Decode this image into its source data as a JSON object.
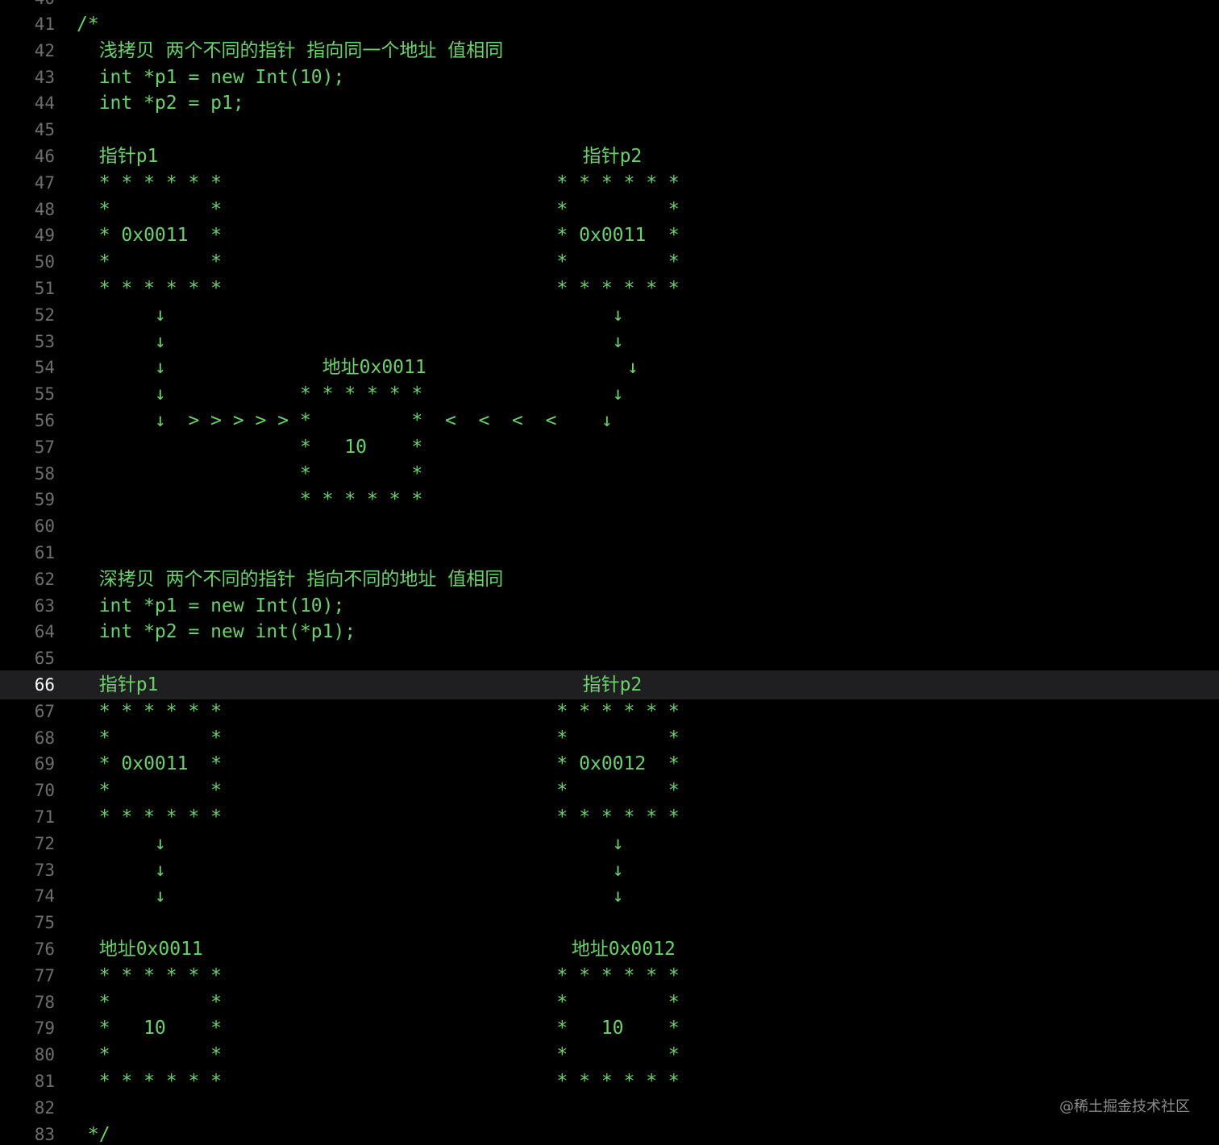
{
  "editor": {
    "top_partial_line": "40",
    "current_line": "66",
    "lines": [
      {
        "num": "41",
        "text": "/*"
      },
      {
        "num": "42",
        "text": "  浅拷贝 两个不同的指针 指向同一个地址 值相同"
      },
      {
        "num": "43",
        "text": "  int *p1 = new Int(10);"
      },
      {
        "num": "44",
        "text": "  int *p2 = p1;"
      },
      {
        "num": "45",
        "text": ""
      },
      {
        "num": "46",
        "text": "  指针p1                                      指针p2"
      },
      {
        "num": "47",
        "text": "  * * * * * *                              * * * * * *"
      },
      {
        "num": "48",
        "text": "  *         *                              *         *"
      },
      {
        "num": "49",
        "text": "  * 0x0011  *                              * 0x0011  *"
      },
      {
        "num": "50",
        "text": "  *         *                              *         *"
      },
      {
        "num": "51",
        "text": "  * * * * * *                              * * * * * *"
      },
      {
        "num": "52",
        "text": "       ↓                                        ↓"
      },
      {
        "num": "53",
        "text": "       ↓                                        ↓"
      },
      {
        "num": "54",
        "text": "       ↓              地址0x0011                  ↓"
      },
      {
        "num": "55",
        "text": "       ↓            * * * * * *                 ↓"
      },
      {
        "num": "56",
        "text": "       ↓  > > > > > *         *  <  <  <  <    ↓"
      },
      {
        "num": "57",
        "text": "                    *   10    *"
      },
      {
        "num": "58",
        "text": "                    *         *"
      },
      {
        "num": "59",
        "text": "                    * * * * * *"
      },
      {
        "num": "60",
        "text": ""
      },
      {
        "num": "61",
        "text": ""
      },
      {
        "num": "62",
        "text": "  深拷贝 两个不同的指针 指向不同的地址 值相同"
      },
      {
        "num": "63",
        "text": "  int *p1 = new Int(10);"
      },
      {
        "num": "64",
        "text": "  int *p2 = new int(*p1);"
      },
      {
        "num": "65",
        "text": ""
      },
      {
        "num": "66",
        "text": "  指针p1                                      指针p2"
      },
      {
        "num": "67",
        "text": "  * * * * * *                              * * * * * *"
      },
      {
        "num": "68",
        "text": "  *         *                              *         *"
      },
      {
        "num": "69",
        "text": "  * 0x0011  *                              * 0x0012  *"
      },
      {
        "num": "70",
        "text": "  *         *                              *         *"
      },
      {
        "num": "71",
        "text": "  * * * * * *                              * * * * * *"
      },
      {
        "num": "72",
        "text": "       ↓                                        ↓"
      },
      {
        "num": "73",
        "text": "       ↓                                        ↓"
      },
      {
        "num": "74",
        "text": "       ↓                                        ↓"
      },
      {
        "num": "75",
        "text": ""
      },
      {
        "num": "76",
        "text": "  地址0x0011                                 地址0x0012"
      },
      {
        "num": "77",
        "text": "  * * * * * *                              * * * * * *"
      },
      {
        "num": "78",
        "text": "  *         *                              *         *"
      },
      {
        "num": "79",
        "text": "  *   10    *                              *   10    *"
      },
      {
        "num": "80",
        "text": "  *         *                              *         *"
      },
      {
        "num": "81",
        "text": "  * * * * * *                              * * * * * *"
      },
      {
        "num": "82",
        "text": ""
      },
      {
        "num": "83",
        "text": " */"
      }
    ]
  },
  "watermark": "@稀土掘金技术社区",
  "colors": {
    "background": "#000000",
    "code_text": "#6bd16b",
    "line_number": "#6f6f72",
    "current_line_number": "#ffffff",
    "current_line_highlight": "#1f1f21",
    "watermark": "#8a8a8a"
  }
}
